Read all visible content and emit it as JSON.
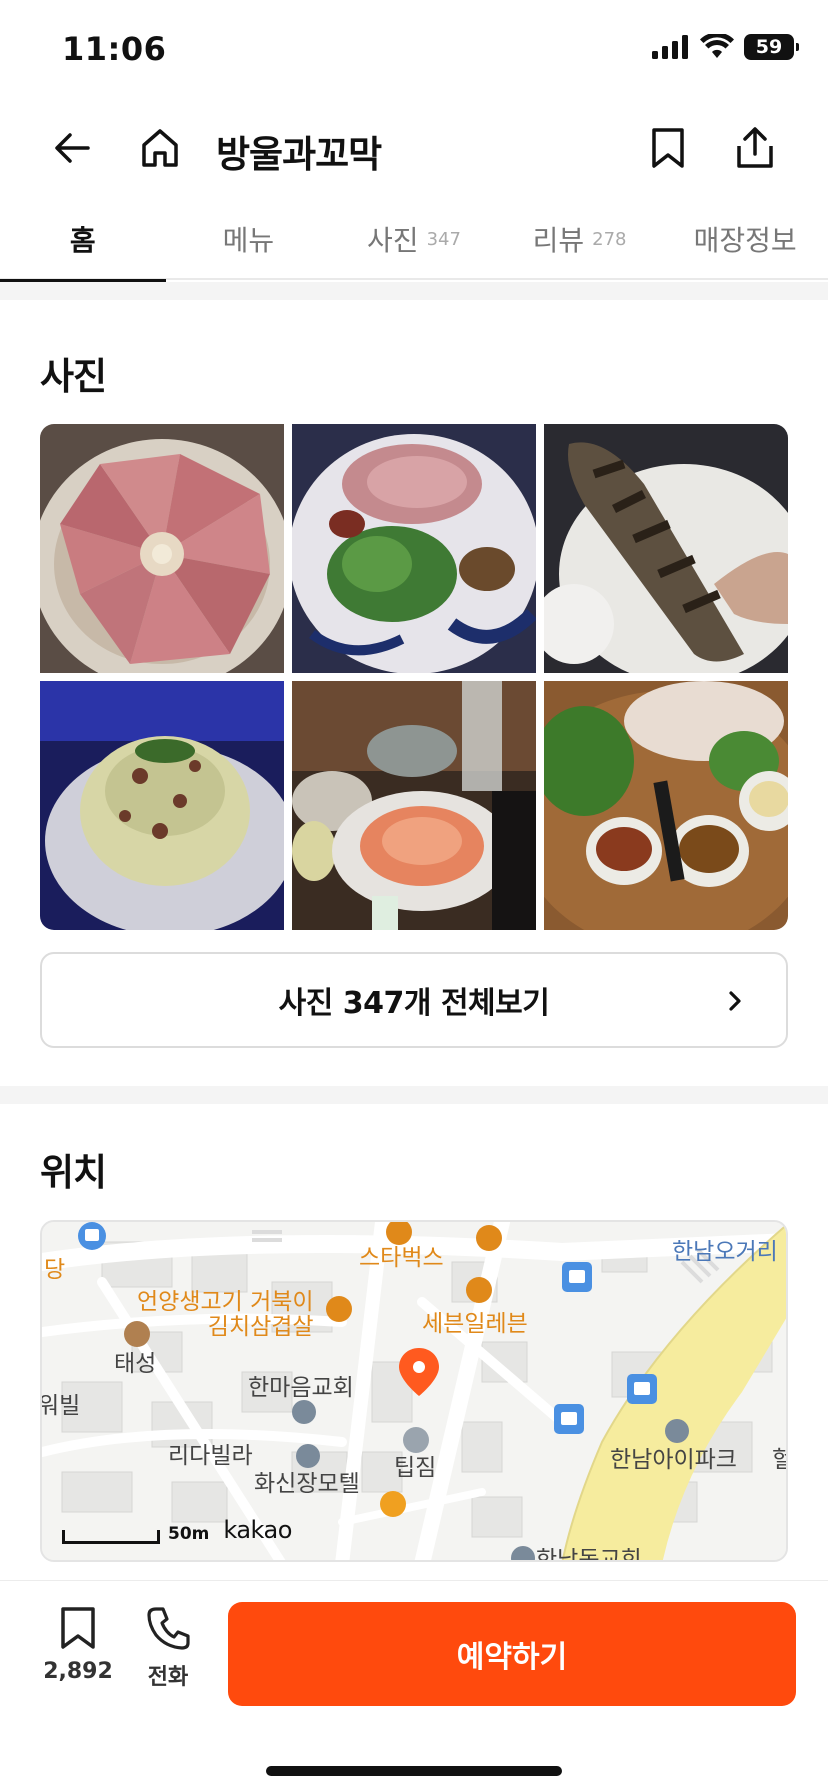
{
  "status_bar": {
    "time": "11:06",
    "battery": "59"
  },
  "header": {
    "title": "방울과꼬막"
  },
  "tabs": [
    {
      "label": "홈",
      "count": ""
    },
    {
      "label": "메뉴",
      "count": ""
    },
    {
      "label": "사진",
      "count": "347"
    },
    {
      "label": "리뷰",
      "count": "278"
    },
    {
      "label": "매장정보",
      "count": ""
    }
  ],
  "photos_section": {
    "title": "사진",
    "view_all_label": "사진 347개 전체보기"
  },
  "location_section": {
    "title": "위치",
    "map": {
      "labels": {
        "starbucks": "스타벅스",
        "hannam_ogeori": "한남오거리",
        "restaurant": "언양생고기 거북이\n김치삼겹살",
        "seven_eleven": "세븐일레븐",
        "taeseong": "태성",
        "hanmaeum_church": "한마음교회",
        "dang": "당",
        "wibil": "워빌",
        "rida_villa": "리다빌라",
        "hwasinjang_motel": "화신장모텔",
        "tipjip": "팁짐",
        "hannam_ipark": "한남아이파크",
        "hae": "헐",
        "hannamdong_church": "한남동교회"
      },
      "scale": "50m",
      "provider": "kakao"
    }
  },
  "bottom_bar": {
    "bookmark_count": "2,892",
    "call_label": "전화",
    "reserve_label": "예약하기"
  },
  "colors": {
    "accent": "#ff4a0d",
    "map_poi": "#e0891a",
    "map_bus": "#4a90e2"
  }
}
